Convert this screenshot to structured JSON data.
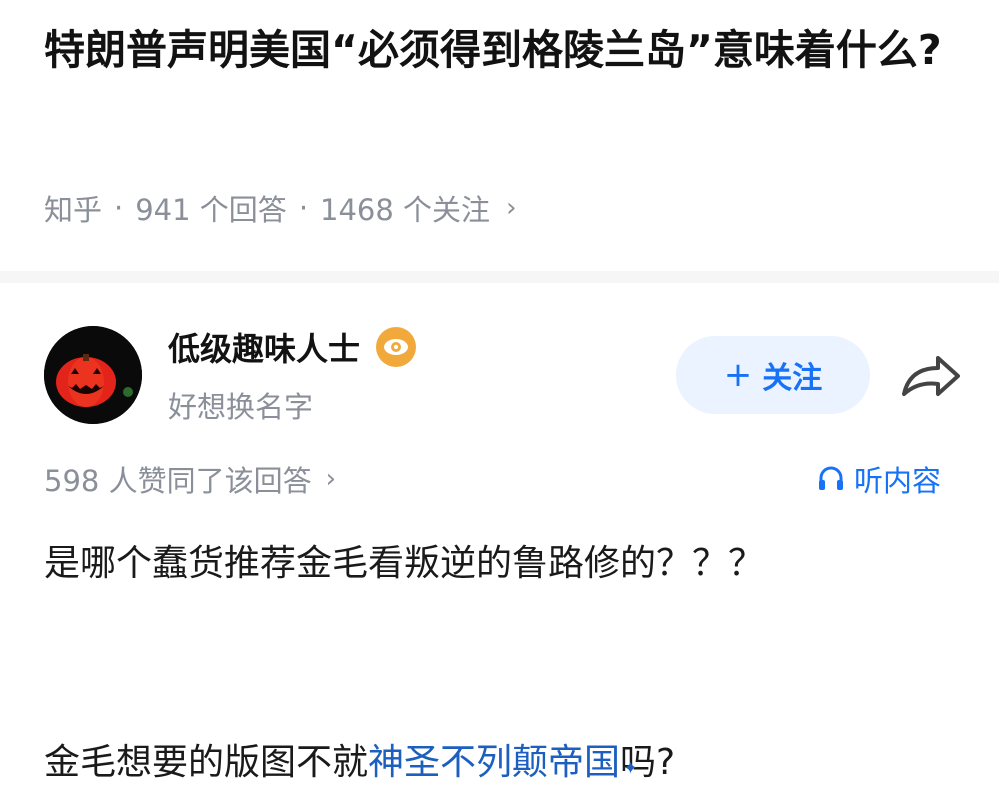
{
  "question": {
    "title": "特朗普声明美国“必须得到格陵兰岛”意味着什么?",
    "meta": {
      "source": "知乎",
      "separator": "·",
      "answers": "941 个回答",
      "followers": "1468 个关注",
      "chevron": "›"
    }
  },
  "answer": {
    "author": {
      "name": "低级趣味人士",
      "subtitle": "好想换名字",
      "avatar_icon": "jack-o-lantern-icon",
      "badge_icon": "eye-badge-icon"
    },
    "follow_button": {
      "plus": "+",
      "label": "关注"
    },
    "share_icon": "share-arrow-icon",
    "likes": {
      "text": "598 人赞同了该回答",
      "chevron": "›"
    },
    "listen": {
      "label": "听内容",
      "icon": "headphones-icon"
    },
    "body": {
      "p1": "是哪个蠢货推荐金毛看叛逆的鲁路修的？？？",
      "p2_before": "金毛想要的版图不就",
      "p2_link": "神圣不列颠帝国",
      "p2_after": "吗?"
    }
  },
  "colors": {
    "accent": "#1772f6",
    "follow_bg": "#eaf3ff",
    "meta_gray": "#8a8f99",
    "link": "#1d5fbf",
    "badge": "#f1a93b"
  }
}
